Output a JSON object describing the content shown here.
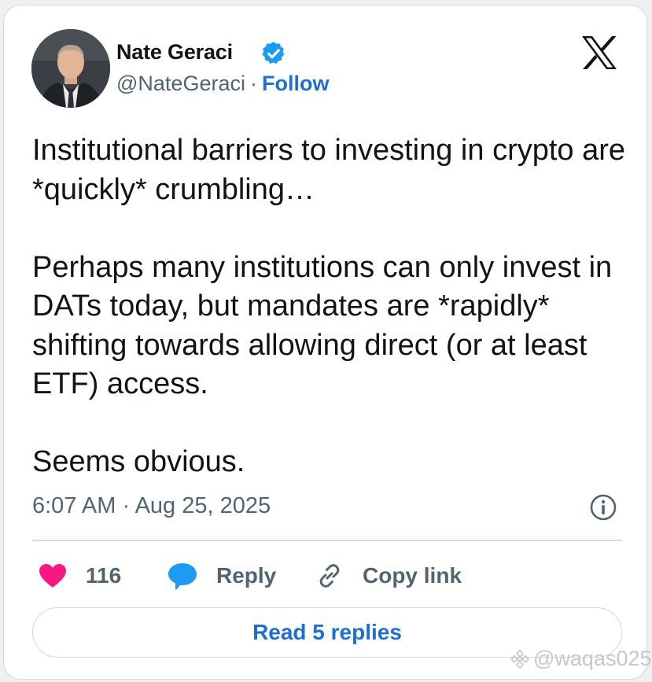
{
  "author": {
    "name": "Nate Geraci",
    "handle": "@NateGeraci",
    "separator": "·",
    "follow_label": "Follow"
  },
  "tweet": {
    "paragraphs": [
      "Institutional barriers to investing in crypto are *quickly* crumbling…",
      "Perhaps many institutions can only invest in DATs today, but mandates are *rapidly* shifting towards allowing direct (or at least ETF) access.",
      "Seems obvious."
    ],
    "timestamp": "6:07 AM · Aug 25, 2025"
  },
  "actions": {
    "likes_count": "116",
    "reply_label": "Reply",
    "copy_link_label": "Copy link"
  },
  "read_replies_label": "Read 5 replies",
  "watermark": "@waqas025",
  "colors": {
    "like": "#f91880",
    "reply_bubble": "#1d9bf0",
    "link_blue": "#1d6fd1",
    "verified": "#1d9bf0"
  },
  "icons": [
    "verified-badge-icon",
    "x-logo-icon",
    "info-icon",
    "heart-icon",
    "reply-bubble-icon",
    "link-icon",
    "binance-logo-icon"
  ]
}
